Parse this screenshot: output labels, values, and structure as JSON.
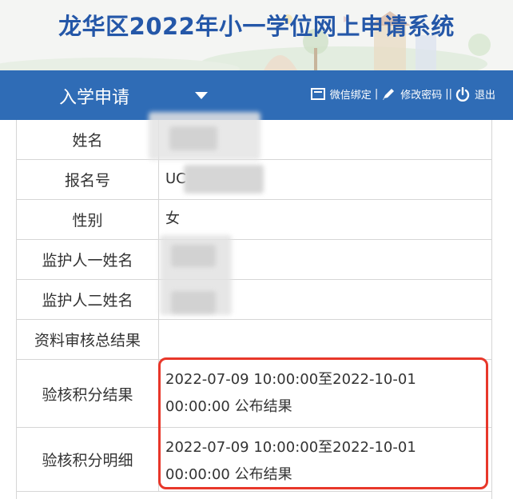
{
  "header": {
    "title": "龙华区2022年小一学位网上申请系统"
  },
  "nav": {
    "title": "入学申请",
    "links": {
      "wechat": "微信绑定",
      "password": "修改密码",
      "logout": "退出"
    }
  },
  "table": {
    "rows": [
      {
        "label": "姓名",
        "value": ""
      },
      {
        "label": "报名号",
        "value": "UC"
      },
      {
        "label": "性别",
        "value": "女"
      },
      {
        "label": "监护人一姓名",
        "value": ""
      },
      {
        "label": "监护人二姓名",
        "value": ""
      },
      {
        "label": "资料审核总结果",
        "value": ""
      },
      {
        "label": "验核积分结果",
        "value": "2022-07-09 10:00:00至2022-10-01 00:00:00 公布结果"
      },
      {
        "label": "验核积分明细",
        "value": "2022-07-09 10:00:00至2022-10-01 00:00:00 公布结果"
      }
    ]
  },
  "colors": {
    "nav_bg": "#2f6cb6",
    "title_blue": "#2457a8",
    "highlight": "#e8372a"
  }
}
